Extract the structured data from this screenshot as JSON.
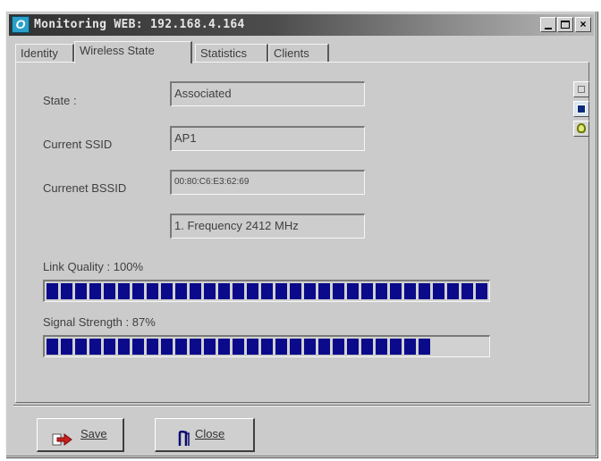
{
  "window": {
    "title": "Monitoring WEB: 192.168.4.164",
    "app_icon_glyph": "O",
    "title_buttons": {
      "minimize": "",
      "maximize": "",
      "close": "×"
    }
  },
  "tabs": [
    {
      "label": "Identity",
      "active": false
    },
    {
      "label": "Wireless State",
      "active": true
    },
    {
      "label": "Statistics",
      "active": false
    },
    {
      "label": "Clients",
      "active": false
    }
  ],
  "state": {
    "state_label": "State :",
    "state_value": "Associated",
    "ssid_label": "Current SSID",
    "ssid_value": "AP1",
    "bssid_label": "Currenet BSSID",
    "bssid_value": "00:80:C6:E3:62:69",
    "channel_value": "1. Frequency 2412 MHz"
  },
  "link_quality": {
    "label": "Link Quality : 100%",
    "percent": 100
  },
  "signal_strength": {
    "label": "Signal Strength : 87%",
    "percent": 87
  },
  "side_buttons": [
    "window-icon",
    "stop-icon",
    "bulb-icon"
  ],
  "buttons": {
    "save_label": "Save",
    "close_label": "Close"
  },
  "colors": {
    "window_bg": "#cbcbcb",
    "bar_fill": "#0a0a8a",
    "title_gradient_start": "#323232",
    "app_icon": "#2aa0c8"
  }
}
